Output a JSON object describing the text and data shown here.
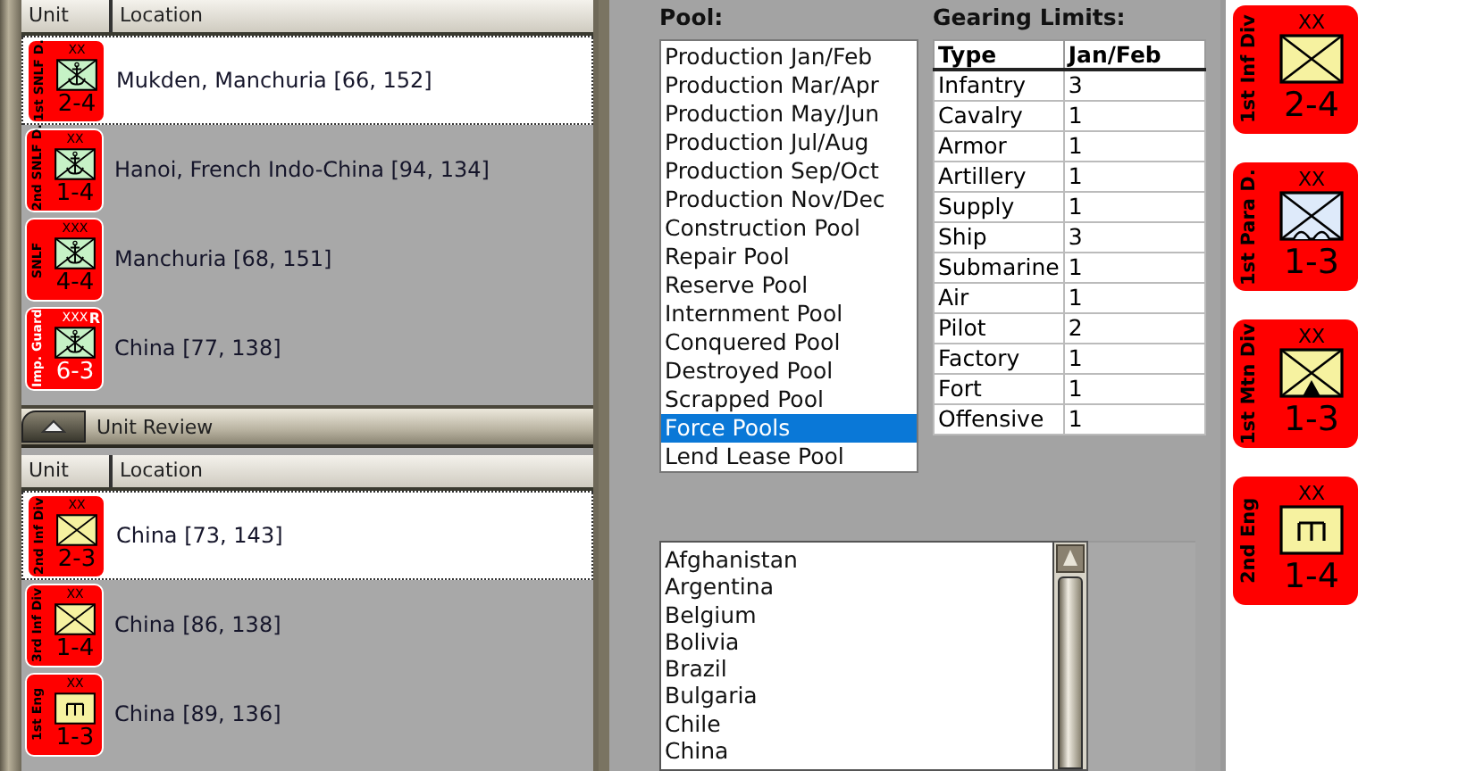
{
  "unit_list": {
    "columns": [
      "Unit",
      "Location"
    ],
    "rows": [
      {
        "selected": true,
        "location": "Mukden, Manchuria [66, 152]",
        "counter": {
          "name": "1st SNLF D.",
          "size": "XX",
          "kind": "marine",
          "strength": "2-4",
          "guard": false
        }
      },
      {
        "selected": false,
        "location": "Hanoi, French Indo-China [94, 134]",
        "counter": {
          "name": "2nd SNLF D.",
          "size": "XX",
          "kind": "marine",
          "strength": "1-4",
          "guard": false
        }
      },
      {
        "selected": false,
        "location": "Manchuria [68, 151]",
        "counter": {
          "name": "SNLF",
          "size": "XXX",
          "kind": "marine",
          "strength": "4-4",
          "guard": false
        }
      },
      {
        "selected": false,
        "location": "China [77, 138]",
        "counter": {
          "name": "Imp. Guard",
          "size": "XXX",
          "kind": "marine",
          "strength": "6-3",
          "guard": true,
          "badge": "R"
        }
      }
    ]
  },
  "unit_review": {
    "title": "Unit Review",
    "columns": [
      "Unit",
      "Location"
    ],
    "rows": [
      {
        "selected": true,
        "location": "China [73, 143]",
        "counter": {
          "name": "2nd Inf Div",
          "size": "XX",
          "kind": "infantry",
          "strength": "2-3",
          "guard": false
        }
      },
      {
        "selected": false,
        "location": "China [86, 138]",
        "counter": {
          "name": "3rd Inf Div",
          "size": "XX",
          "kind": "infantry",
          "strength": "1-4",
          "guard": false
        }
      },
      {
        "selected": false,
        "location": "China [89, 136]",
        "counter": {
          "name": "1st Eng",
          "size": "XX",
          "kind": "engineer",
          "strength": "1-3",
          "guard": false
        }
      }
    ]
  },
  "pool": {
    "label": "Pool:",
    "items": [
      {
        "label": "Production Jan/Feb",
        "selected": false
      },
      {
        "label": "Production Mar/Apr",
        "selected": false
      },
      {
        "label": "Production May/Jun",
        "selected": false
      },
      {
        "label": "Production Jul/Aug",
        "selected": false
      },
      {
        "label": "Production Sep/Oct",
        "selected": false
      },
      {
        "label": "Production Nov/Dec",
        "selected": false
      },
      {
        "label": "Construction Pool",
        "selected": false
      },
      {
        "label": "Repair Pool",
        "selected": false
      },
      {
        "label": "Reserve Pool",
        "selected": false
      },
      {
        "label": "Internment Pool",
        "selected": false
      },
      {
        "label": "Conquered Pool",
        "selected": false
      },
      {
        "label": "Destroyed Pool",
        "selected": false
      },
      {
        "label": "Scrapped Pool",
        "selected": false
      },
      {
        "label": "Force Pools",
        "selected": true
      },
      {
        "label": "Lend Lease Pool",
        "selected": false
      }
    ]
  },
  "gearing": {
    "label": "Gearing Limits:",
    "columns": [
      "Type",
      "Jan/Feb"
    ],
    "rows": [
      [
        "Infantry",
        "3"
      ],
      [
        "Cavalry",
        "1"
      ],
      [
        "Armor",
        "1"
      ],
      [
        "Artillery",
        "1"
      ],
      [
        "Supply",
        "1"
      ],
      [
        "Ship",
        "3"
      ],
      [
        "Submarine",
        "1"
      ],
      [
        "Air",
        "1"
      ],
      [
        "Pilot",
        "2"
      ],
      [
        "Factory",
        "1"
      ],
      [
        "Fort",
        "1"
      ],
      [
        "Offensive",
        "1"
      ]
    ]
  },
  "countries": {
    "items": [
      "Afghanistan",
      "Argentina",
      "Belgium",
      "Bolivia",
      "Brazil",
      "Bulgaria",
      "Chile",
      "China"
    ]
  },
  "counters": [
    {
      "name": "1st Inf Div",
      "size": "XX",
      "kind": "infantry",
      "strength": "2-4",
      "guard": false
    },
    {
      "name": "1st Para D.",
      "size": "XX",
      "kind": "para",
      "strength": "1-3",
      "guard": false
    },
    {
      "name": "1st Mtn Div",
      "size": "XX",
      "kind": "mountain",
      "strength": "1-3",
      "guard": false
    },
    {
      "name": "2nd Eng",
      "size": "XX",
      "kind": "engineer",
      "strength": "1-4",
      "guard": false
    }
  ]
}
